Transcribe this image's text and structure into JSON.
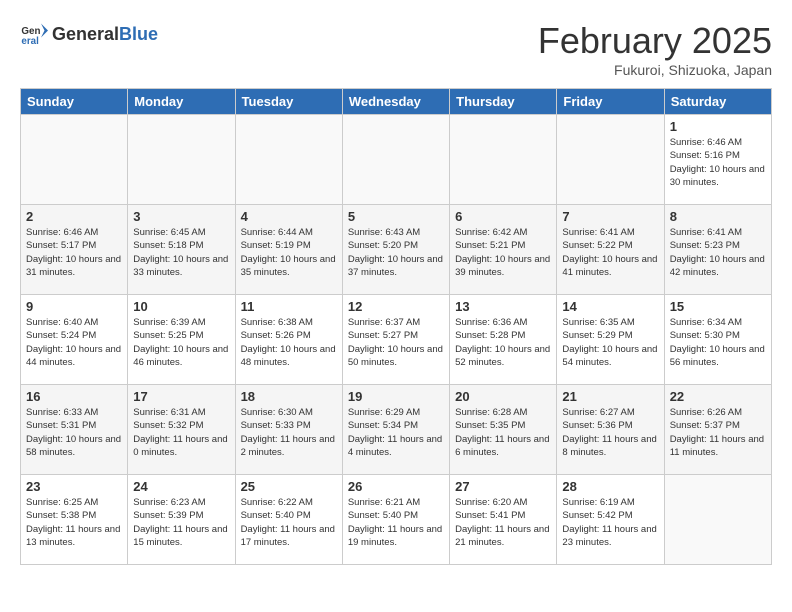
{
  "header": {
    "logo_general": "General",
    "logo_blue": "Blue",
    "month_title": "February 2025",
    "location": "Fukuroi, Shizuoka, Japan"
  },
  "days_of_week": [
    "Sunday",
    "Monday",
    "Tuesday",
    "Wednesday",
    "Thursday",
    "Friday",
    "Saturday"
  ],
  "weeks": [
    [
      {
        "day": "",
        "info": ""
      },
      {
        "day": "",
        "info": ""
      },
      {
        "day": "",
        "info": ""
      },
      {
        "day": "",
        "info": ""
      },
      {
        "day": "",
        "info": ""
      },
      {
        "day": "",
        "info": ""
      },
      {
        "day": "1",
        "info": "Sunrise: 6:46 AM\nSunset: 5:16 PM\nDaylight: 10 hours and 30 minutes."
      }
    ],
    [
      {
        "day": "2",
        "info": "Sunrise: 6:46 AM\nSunset: 5:17 PM\nDaylight: 10 hours and 31 minutes."
      },
      {
        "day": "3",
        "info": "Sunrise: 6:45 AM\nSunset: 5:18 PM\nDaylight: 10 hours and 33 minutes."
      },
      {
        "day": "4",
        "info": "Sunrise: 6:44 AM\nSunset: 5:19 PM\nDaylight: 10 hours and 35 minutes."
      },
      {
        "day": "5",
        "info": "Sunrise: 6:43 AM\nSunset: 5:20 PM\nDaylight: 10 hours and 37 minutes."
      },
      {
        "day": "6",
        "info": "Sunrise: 6:42 AM\nSunset: 5:21 PM\nDaylight: 10 hours and 39 minutes."
      },
      {
        "day": "7",
        "info": "Sunrise: 6:41 AM\nSunset: 5:22 PM\nDaylight: 10 hours and 41 minutes."
      },
      {
        "day": "8",
        "info": "Sunrise: 6:41 AM\nSunset: 5:23 PM\nDaylight: 10 hours and 42 minutes."
      }
    ],
    [
      {
        "day": "9",
        "info": "Sunrise: 6:40 AM\nSunset: 5:24 PM\nDaylight: 10 hours and 44 minutes."
      },
      {
        "day": "10",
        "info": "Sunrise: 6:39 AM\nSunset: 5:25 PM\nDaylight: 10 hours and 46 minutes."
      },
      {
        "day": "11",
        "info": "Sunrise: 6:38 AM\nSunset: 5:26 PM\nDaylight: 10 hours and 48 minutes."
      },
      {
        "day": "12",
        "info": "Sunrise: 6:37 AM\nSunset: 5:27 PM\nDaylight: 10 hours and 50 minutes."
      },
      {
        "day": "13",
        "info": "Sunrise: 6:36 AM\nSunset: 5:28 PM\nDaylight: 10 hours and 52 minutes."
      },
      {
        "day": "14",
        "info": "Sunrise: 6:35 AM\nSunset: 5:29 PM\nDaylight: 10 hours and 54 minutes."
      },
      {
        "day": "15",
        "info": "Sunrise: 6:34 AM\nSunset: 5:30 PM\nDaylight: 10 hours and 56 minutes."
      }
    ],
    [
      {
        "day": "16",
        "info": "Sunrise: 6:33 AM\nSunset: 5:31 PM\nDaylight: 10 hours and 58 minutes."
      },
      {
        "day": "17",
        "info": "Sunrise: 6:31 AM\nSunset: 5:32 PM\nDaylight: 11 hours and 0 minutes."
      },
      {
        "day": "18",
        "info": "Sunrise: 6:30 AM\nSunset: 5:33 PM\nDaylight: 11 hours and 2 minutes."
      },
      {
        "day": "19",
        "info": "Sunrise: 6:29 AM\nSunset: 5:34 PM\nDaylight: 11 hours and 4 minutes."
      },
      {
        "day": "20",
        "info": "Sunrise: 6:28 AM\nSunset: 5:35 PM\nDaylight: 11 hours and 6 minutes."
      },
      {
        "day": "21",
        "info": "Sunrise: 6:27 AM\nSunset: 5:36 PM\nDaylight: 11 hours and 8 minutes."
      },
      {
        "day": "22",
        "info": "Sunrise: 6:26 AM\nSunset: 5:37 PM\nDaylight: 11 hours and 11 minutes."
      }
    ],
    [
      {
        "day": "23",
        "info": "Sunrise: 6:25 AM\nSunset: 5:38 PM\nDaylight: 11 hours and 13 minutes."
      },
      {
        "day": "24",
        "info": "Sunrise: 6:23 AM\nSunset: 5:39 PM\nDaylight: 11 hours and 15 minutes."
      },
      {
        "day": "25",
        "info": "Sunrise: 6:22 AM\nSunset: 5:40 PM\nDaylight: 11 hours and 17 minutes."
      },
      {
        "day": "26",
        "info": "Sunrise: 6:21 AM\nSunset: 5:40 PM\nDaylight: 11 hours and 19 minutes."
      },
      {
        "day": "27",
        "info": "Sunrise: 6:20 AM\nSunset: 5:41 PM\nDaylight: 11 hours and 21 minutes."
      },
      {
        "day": "28",
        "info": "Sunrise: 6:19 AM\nSunset: 5:42 PM\nDaylight: 11 hours and 23 minutes."
      },
      {
        "day": "",
        "info": ""
      }
    ]
  ]
}
